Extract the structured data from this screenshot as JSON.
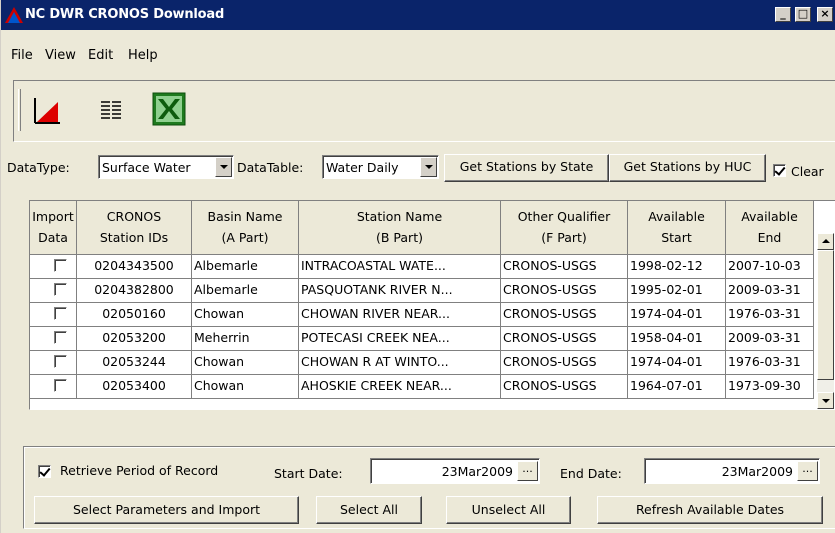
{
  "window": {
    "title": "NC DWR CRONOS Download",
    "controls": {
      "minimize": "_",
      "maximize": "□",
      "close": "×"
    }
  },
  "menu": [
    "File",
    "View",
    "Edit",
    "Help"
  ],
  "toolbar": {
    "icons": [
      "chart-icon",
      "text-report-icon",
      "excel-icon"
    ]
  },
  "filters": {
    "datatype_label": "DataType:",
    "datatype_value": "Surface Water",
    "datatable_label": "DataTable:",
    "datatable_value": "Water Daily",
    "btn_state": "Get Stations by State",
    "btn_huc": "Get Stations by HUC",
    "clear_label": "Clear",
    "clear_checked": true
  },
  "table": {
    "headers": [
      [
        "Import",
        "Data"
      ],
      [
        "CRONOS",
        "Station IDs"
      ],
      [
        "Basin Name",
        "(A Part)"
      ],
      [
        "Station Name",
        "(B Part)"
      ],
      [
        "Other Qualifier",
        "(F Part)"
      ],
      [
        "Available",
        "Start"
      ],
      [
        "Available",
        "End"
      ]
    ],
    "rows": [
      {
        "import": false,
        "id": "0204343500",
        "basin": "Albemarle",
        "station": "INTRACOASTAL WATE...",
        "qualifier": "CRONOS-USGS",
        "start": "1998-02-12",
        "end": "2007-10-03"
      },
      {
        "import": false,
        "id": "0204382800",
        "basin": "Albemarle",
        "station": "PASQUOTANK RIVER N...",
        "qualifier": "CRONOS-USGS",
        "start": "1995-02-01",
        "end": "2009-03-31"
      },
      {
        "import": false,
        "id": "02050160",
        "basin": "Chowan",
        "station": "CHOWAN RIVER NEAR...",
        "qualifier": "CRONOS-USGS",
        "start": "1974-04-01",
        "end": "1976-03-31"
      },
      {
        "import": false,
        "id": "02053200",
        "basin": "Meherrin",
        "station": "POTECASI CREEK NEA...",
        "qualifier": "CRONOS-USGS",
        "start": "1958-04-01",
        "end": "2009-03-31"
      },
      {
        "import": false,
        "id": "02053244",
        "basin": "Chowan",
        "station": "CHOWAN R AT WINTO...",
        "qualifier": "CRONOS-USGS",
        "start": "1974-04-01",
        "end": "1976-03-31"
      },
      {
        "import": false,
        "id": "02053400",
        "basin": "Chowan",
        "station": "AHOSKIE CREEK NEAR...",
        "qualifier": "CRONOS-USGS",
        "start": "1964-07-01",
        "end": "1973-09-30"
      }
    ]
  },
  "bottom": {
    "retrieve_label": "Retrieve Period of Record",
    "retrieve_checked": true,
    "start_label": "Start Date:",
    "start_value": "23Mar2009",
    "end_label": "End Date:",
    "end_value": "23Mar2009",
    "date_btn": "...",
    "btn_select_params": "Select Parameters and Import",
    "btn_select_all": "Select All",
    "btn_unselect_all": "Unselect All",
    "btn_refresh": "Refresh Available Dates"
  }
}
